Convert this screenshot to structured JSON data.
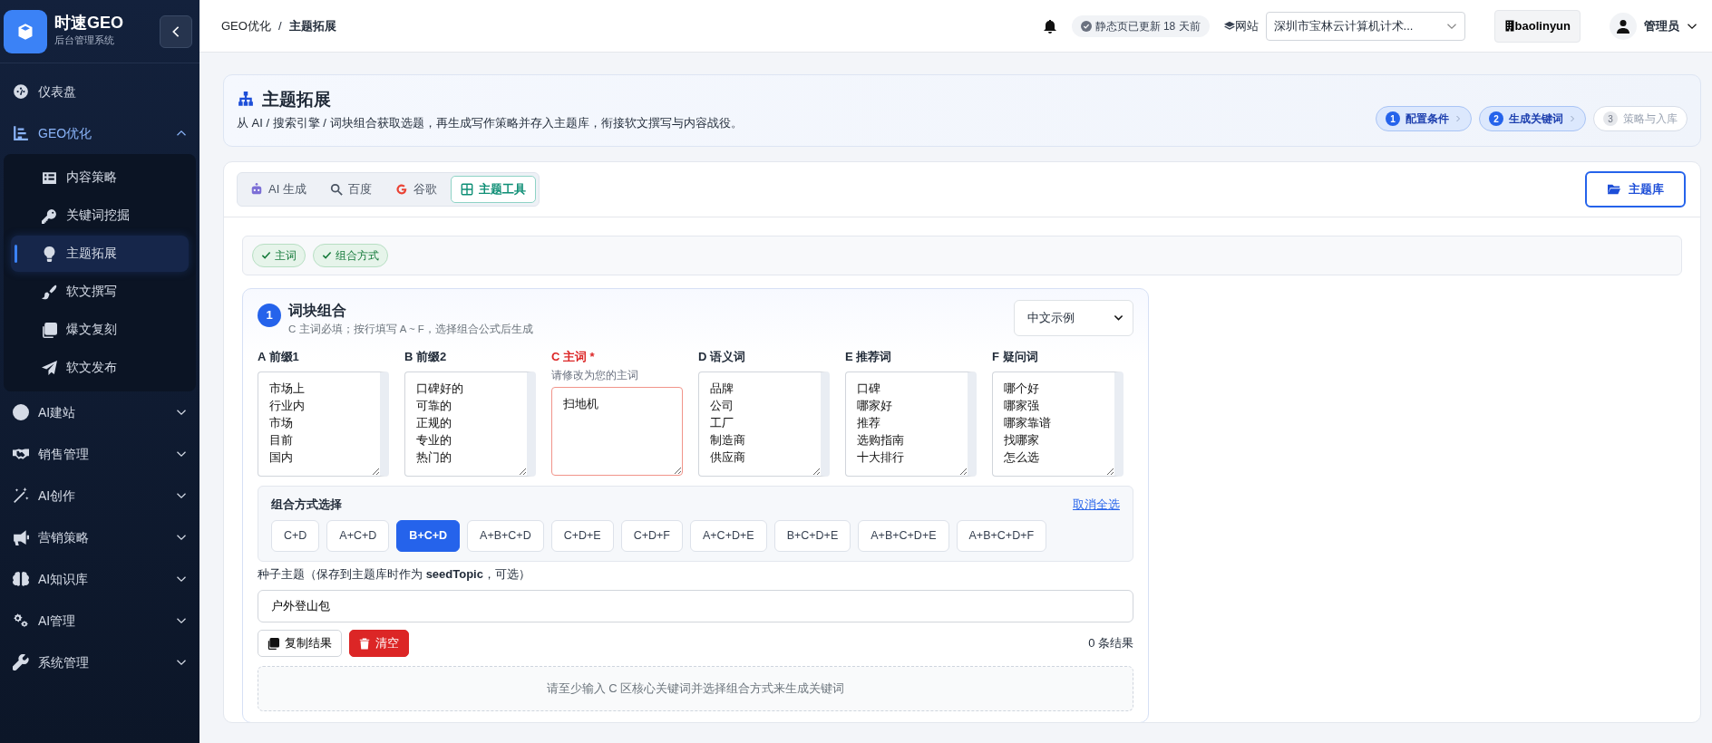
{
  "sidebar": {
    "brand": {
      "title": "时速GEO",
      "subtitle": "后台管理系统"
    },
    "items": [
      {
        "label": "仪表盘",
        "selected": false
      },
      {
        "label": "GEO优化",
        "selected": true,
        "expanded": true,
        "children": [
          {
            "label": "内容策略",
            "selected": false
          },
          {
            "label": "关键词挖掘",
            "selected": false
          },
          {
            "label": "主题拓展",
            "selected": true
          },
          {
            "label": "软文撰写",
            "selected": false
          },
          {
            "label": "爆文复刻",
            "selected": false
          },
          {
            "label": "软文发布",
            "selected": false
          }
        ]
      },
      {
        "label": "AI建站",
        "selected": false,
        "expanded": false
      },
      {
        "label": "销售管理",
        "selected": false,
        "expanded": false
      },
      {
        "label": "AI创作",
        "selected": false,
        "expanded": false
      },
      {
        "label": "营销策略",
        "selected": false,
        "expanded": false
      },
      {
        "label": "AI知识库",
        "selected": false,
        "expanded": false
      },
      {
        "label": "AI管理",
        "selected": false,
        "expanded": false
      },
      {
        "label": "系统管理",
        "selected": false,
        "expanded": false
      }
    ]
  },
  "topbar": {
    "breadcrumb": [
      "GEO优化",
      "/",
      "主题拓展"
    ],
    "status": "静态页已更新 18 天前",
    "site_label": "网站",
    "site_select": "深圳市宝林云计算机计术...",
    "account_button": "baolinyun",
    "user": "管理员"
  },
  "header": {
    "title": "主题拓展",
    "subtitle": "从 AI / 搜索引擎 / 词块组合获取选题，再生成写作策略并存入主题库，衔接软文撰写与内容战役。",
    "steps": [
      {
        "number": "1",
        "label": "配置条件",
        "active": true
      },
      {
        "number": "2",
        "label": "生成关键词",
        "active": true
      },
      {
        "number": "3",
        "label": "策略与入库",
        "active": false
      }
    ]
  },
  "tabs": [
    {
      "label": "AI 生成",
      "selected": false
    },
    {
      "label": "百度",
      "selected": false
    },
    {
      "label": "谷歌",
      "selected": false
    },
    {
      "label": "主题工具",
      "selected": true
    }
  ],
  "library_button": "主题库",
  "checks": [
    {
      "label": "主词",
      "checked": true
    },
    {
      "label": "组合方式",
      "checked": true
    }
  ],
  "block": {
    "number": "1",
    "title": "词块组合",
    "hint": "C 主词必填；按行填写 A ~ F，选择组合公式后生成",
    "preset_select": "中文示例",
    "columns": [
      {
        "label": "A 前缀1",
        "required": false,
        "lines": [
          "市场上",
          "行业内",
          "市场",
          "目前",
          "国内"
        ]
      },
      {
        "label": "B 前缀2",
        "required": false,
        "lines": [
          "口碑好的",
          "可靠的",
          "正规的",
          "专业的",
          "热门的"
        ]
      },
      {
        "label": "C 主词",
        "required": true,
        "marker": "*",
        "hint": "请修改为您的主词",
        "lines": [
          "扫地机"
        ]
      },
      {
        "label": "D 语义词",
        "required": false,
        "lines": [
          "品牌",
          "公司",
          "工厂",
          "制造商",
          "供应商"
        ]
      },
      {
        "label": "E 推荐词",
        "required": false,
        "lines": [
          "口碑",
          "哪家好",
          "推荐",
          "选购指南",
          "十大排行"
        ]
      },
      {
        "label": "F 疑问词",
        "required": false,
        "lines": [
          "哪个好",
          "哪家强",
          "哪家靠谱",
          "找哪家",
          "怎么选"
        ]
      }
    ],
    "combos": {
      "title": "组合方式选择",
      "clear_link": "取消全选",
      "options": [
        {
          "label": "C+D",
          "selected": false
        },
        {
          "label": "A+C+D",
          "selected": false
        },
        {
          "label": "B+C+D",
          "selected": true
        },
        {
          "label": "A+B+C+D",
          "selected": false
        },
        {
          "label": "C+D+E",
          "selected": false
        },
        {
          "label": "C+D+F",
          "selected": false
        },
        {
          "label": "A+C+D+E",
          "selected": false
        },
        {
          "label": "B+C+D+E",
          "selected": false
        },
        {
          "label": "A+B+C+D+E",
          "selected": false
        },
        {
          "label": "A+B+C+D+F",
          "selected": false
        }
      ]
    },
    "seed_label": "种子主题（保存到主题库时作为 **seedTopic**，可选）",
    "seed_value": "户外登山包",
    "copy_button": "复制结果",
    "clear_button": "清空",
    "result_count": "0 条结果",
    "empty_message": "请至少输入 C 区核心关键词并选择组合方式来生成关键词"
  }
}
